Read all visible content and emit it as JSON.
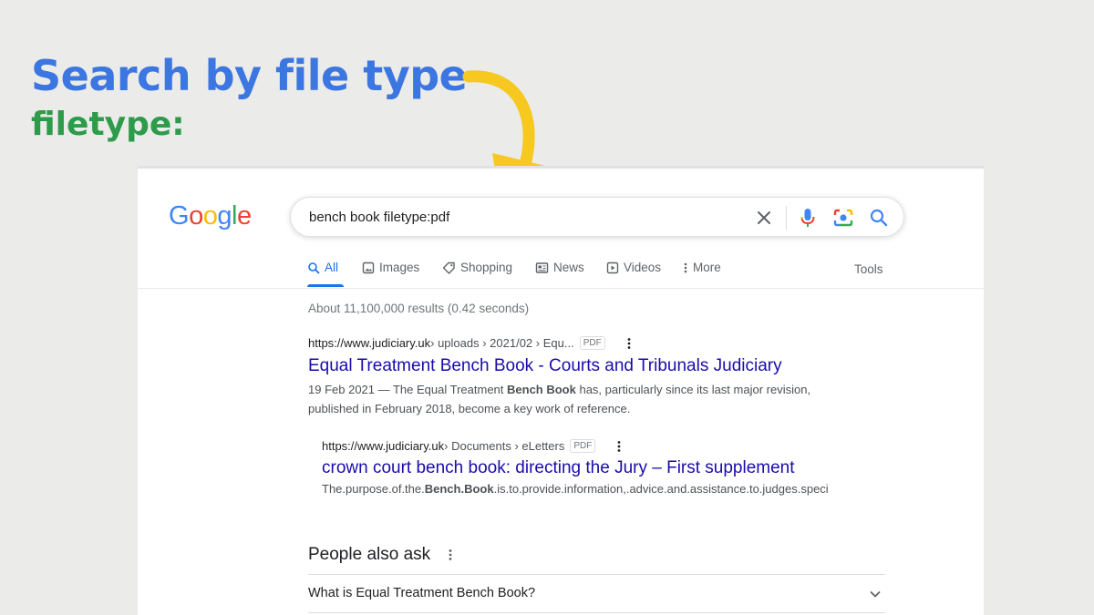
{
  "slide": {
    "title": "Search by file type",
    "subtitle": "filetype:"
  },
  "colors": {
    "title_blue": "#3b76e1",
    "subtitle_green": "#2d9b4a",
    "arrow_yellow": "#f6c820",
    "link_blue": "#1a0dab",
    "tab_active": "#1a73e8"
  },
  "google": {
    "logo_letters": [
      "G",
      "o",
      "o",
      "g",
      "l",
      "e"
    ],
    "search_query": "bench book filetype:pdf",
    "icons": [
      "close-icon",
      "microphone-icon",
      "camera-lens-icon",
      "search-icon"
    ],
    "tabs": [
      {
        "label": "All",
        "icon": "search-icon",
        "active": true
      },
      {
        "label": "Images",
        "icon": "image-icon"
      },
      {
        "label": "Shopping",
        "icon": "tag-icon"
      },
      {
        "label": "News",
        "icon": "newspaper-icon"
      },
      {
        "label": "Videos",
        "icon": "play-icon"
      },
      {
        "label": "More",
        "icon": "more-vert-icon"
      }
    ],
    "tools_label": "Tools",
    "stats": "About 11,100,000 results (0.42 seconds)",
    "results": [
      {
        "domain": "https://www.judiciary.uk",
        "path": " › uploads › 2021/02 › Equ...",
        "badge": "PDF",
        "title": "Equal Treatment Bench Book - Courts and Tribunals Judiciary",
        "snippet_before": "19 Feb 2021 — The Equal Treatment ",
        "snippet_bold": "Bench Book",
        "snippet_after": " has, particularly since its last major revision, published in February 2018, become a key work of reference."
      },
      {
        "domain": "https://www.judiciary.uk",
        "path": " › Documents › eLetters",
        "badge": "PDF",
        "title": "crown court bench book: directing the Jury – First supplement",
        "snippet_before": "The.purpose.of.the.",
        "snippet_bold": "Bench.Book",
        "snippet_after": ".is.to.provide.information,.advice.and.assistance.to.judges.speci"
      }
    ],
    "people_also_ask": {
      "title": "People also ask",
      "questions": [
        "What is Equal Treatment Bench Book?"
      ]
    }
  }
}
